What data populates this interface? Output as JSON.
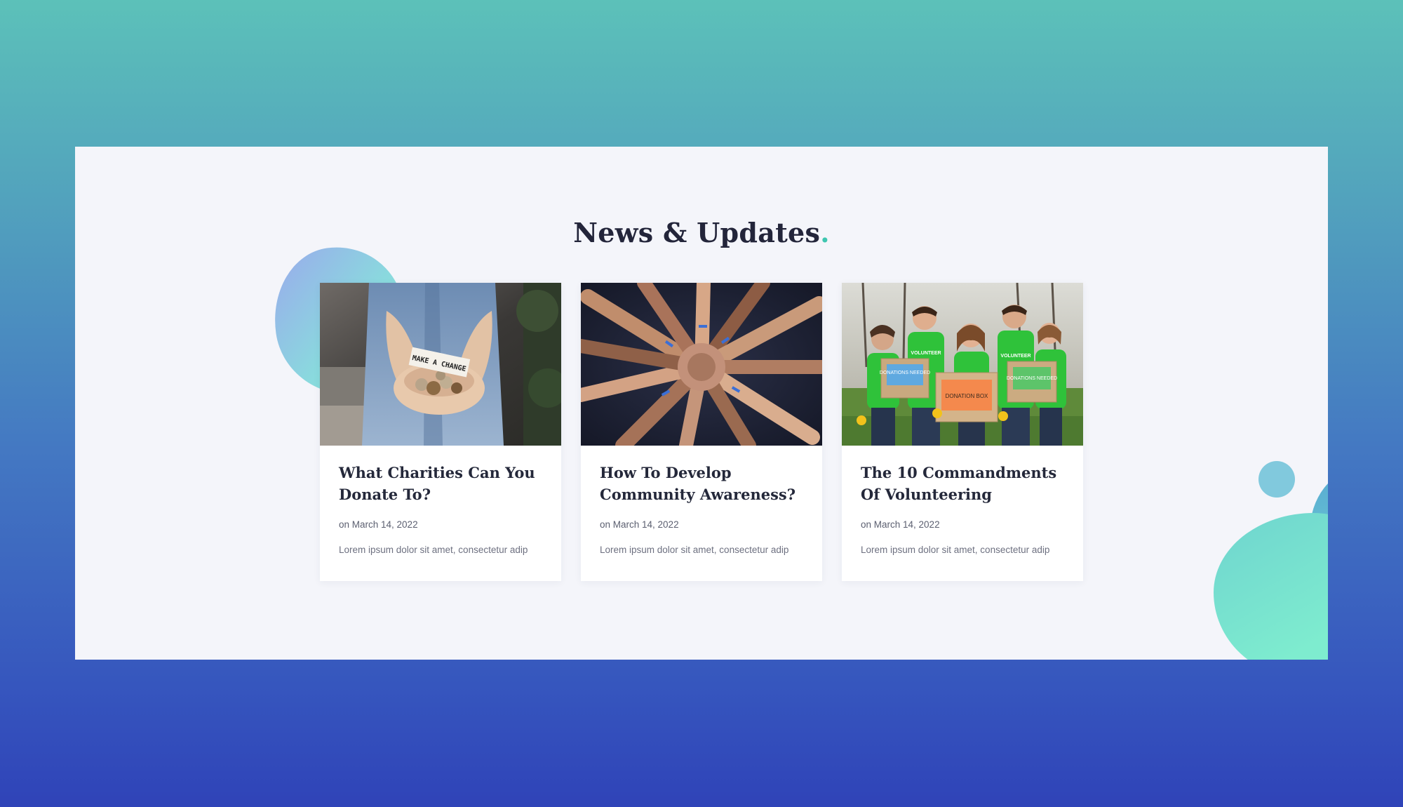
{
  "section": {
    "title": "News & Updates",
    "title_accent": "."
  },
  "posts": [
    {
      "title": "What Charities Can You Donate To?",
      "date": "on March 14, 2022",
      "excerpt": "Lorem ipsum dolor sit amet, consectetur adip",
      "image": "hands-holding-coins-make-a-change-photo",
      "image_note": "MAKE A CHANGE"
    },
    {
      "title": "How To Develop Community Awareness?",
      "date": "on March 14, 2022",
      "excerpt": "Lorem ipsum dolor sit amet, consectetur adip",
      "image": "circle-of-hands-photo"
    },
    {
      "title": "The 10 Commandments Of Volunteering",
      "date": "on March 14, 2022",
      "excerpt": "Lorem ipsum dolor sit amet, consectetur adip",
      "image": "volunteers-with-donation-boxes-photo",
      "image_labels": {
        "shirt": "VOLUNTEER",
        "box_left": "DONATIONS NEEDED",
        "box_center": "DONATION BOX",
        "box_right": "DONATIONS NEEDED"
      }
    }
  ],
  "colors": {
    "accent": "#3ec6b0",
    "heading": "#23253a",
    "panel": "#f4f5fa"
  }
}
